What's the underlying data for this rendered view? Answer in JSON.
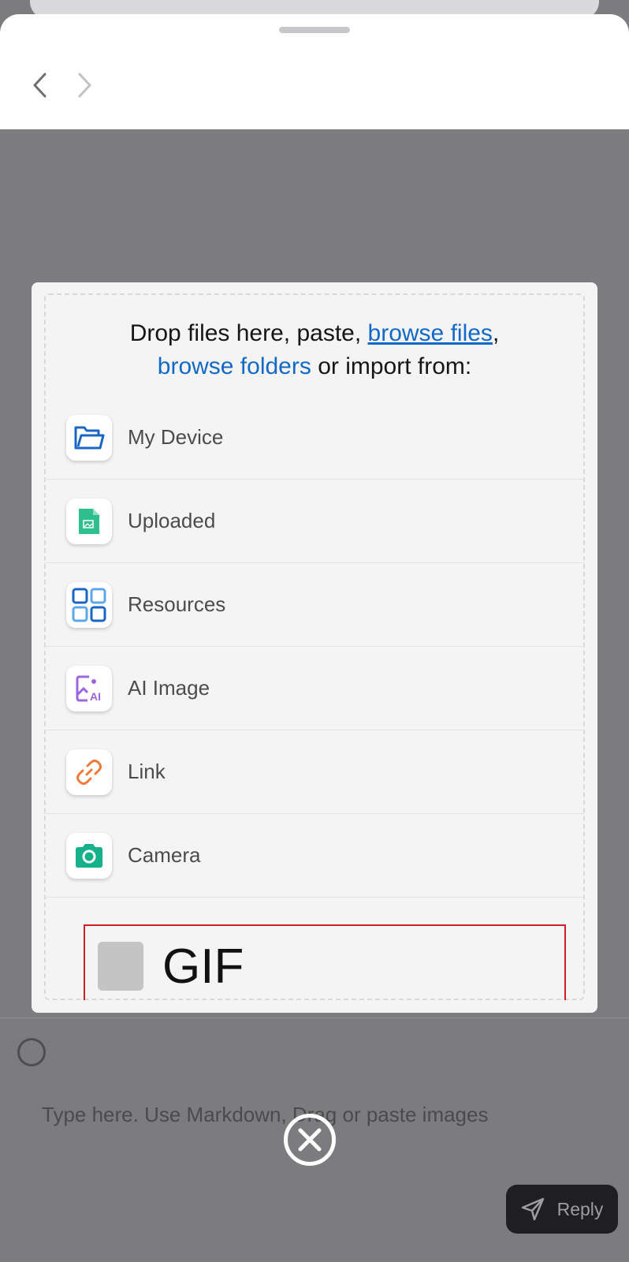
{
  "topbar": {
    "back_icon": "chevron-left-icon",
    "forward_icon": "chevron-right-icon"
  },
  "uploader": {
    "title_prefix": "Drop files here, paste, ",
    "browse_files": "browse files",
    "title_comma": ",",
    "browse_folders": "browse folders",
    "title_suffix": " or import from:",
    "link_color": "#1269c7",
    "sources": [
      {
        "label": "My Device",
        "icon": "folder-icon"
      },
      {
        "label": "Uploaded",
        "icon": "uploaded-file-icon"
      },
      {
        "label": "Resources",
        "icon": "grid-icon"
      },
      {
        "label": "AI Image",
        "icon": "ai-image-icon"
      },
      {
        "label": "Link",
        "icon": "link-icon"
      },
      {
        "label": "Camera",
        "icon": "camera-icon"
      }
    ],
    "gif_label": "GIF",
    "highlight_color": "#cc1f2a"
  },
  "composer": {
    "placeholder": "Type here. Use Markdown, Drag or paste images",
    "reply_label": "Reply"
  }
}
